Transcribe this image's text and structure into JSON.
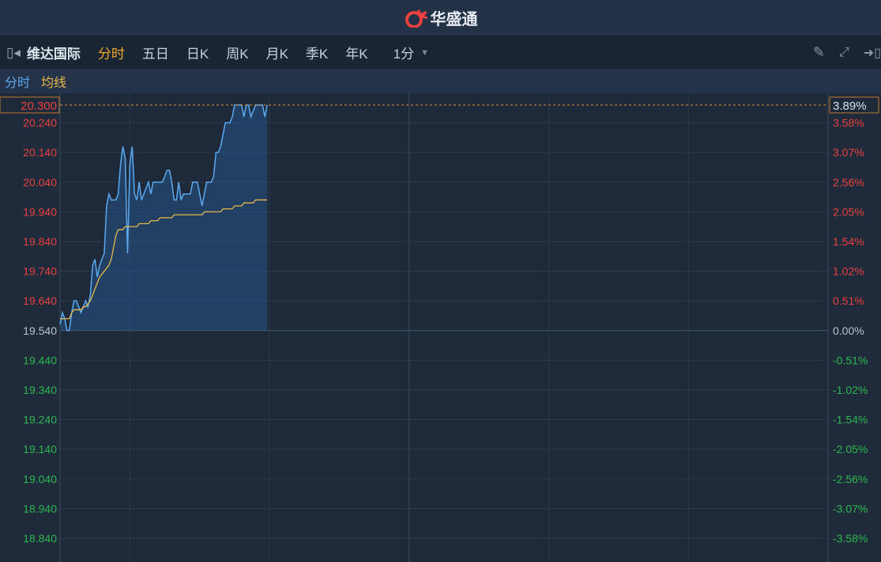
{
  "header": {
    "brand": "华盛通",
    "logo_icon": "huashengtong-logo"
  },
  "toolbar": {
    "stock_name": "维达国际",
    "tabs": [
      "分时",
      "五日",
      "日K",
      "周K",
      "月K",
      "季K",
      "年K"
    ],
    "active_tab": "分时",
    "interval": "1分"
  },
  "legend": {
    "line": "分时",
    "avg": "均线"
  },
  "colors": {
    "up": "#e8413e",
    "down": "#2db84d",
    "price_line": "#5aa9f0",
    "avg_line": "#e6b94a",
    "active": "#f0a830"
  },
  "chart_data": {
    "type": "line",
    "base_price": 19.54,
    "current_price_label": "20.300",
    "current_pct_label": "3.89%",
    "ylim": [
      18.8,
      20.3
    ],
    "y_ticks": [
      {
        "price": "20.240",
        "pct": "3.58%",
        "v": 20.24
      },
      {
        "price": "20.140",
        "pct": "3.07%",
        "v": 20.14
      },
      {
        "price": "20.040",
        "pct": "2.56%",
        "v": 20.04
      },
      {
        "price": "19.940",
        "pct": "2.05%",
        "v": 19.94
      },
      {
        "price": "19.840",
        "pct": "1.54%",
        "v": 19.84
      },
      {
        "price": "19.740",
        "pct": "1.02%",
        "v": 19.74
      },
      {
        "price": "19.640",
        "pct": "0.51%",
        "v": 19.64
      },
      {
        "price": "19.540",
        "pct": "0.00%",
        "v": 19.54
      },
      {
        "price": "19.440",
        "pct": "-0.51%",
        "v": 19.44
      },
      {
        "price": "19.340",
        "pct": "-1.02%",
        "v": 19.34
      },
      {
        "price": "19.240",
        "pct": "-1.54%",
        "v": 19.24
      },
      {
        "price": "19.140",
        "pct": "-2.05%",
        "v": 19.14
      },
      {
        "price": "19.040",
        "pct": "-2.56%",
        "v": 19.04
      },
      {
        "price": "18.940",
        "pct": "-3.07%",
        "v": 18.94
      },
      {
        "price": "18.840",
        "pct": "-3.58%",
        "v": 18.84
      }
    ],
    "session_minutes": 330,
    "vertical_grid_minutes": [
      30,
      90,
      150,
      210,
      270
    ],
    "series": [
      {
        "name": "分时",
        "values": [
          19.56,
          19.6,
          19.58,
          19.54,
          19.54,
          19.6,
          19.64,
          19.64,
          19.62,
          19.6,
          19.62,
          19.64,
          19.62,
          19.66,
          19.76,
          19.78,
          19.72,
          19.76,
          19.78,
          19.8,
          19.96,
          20.0,
          19.98,
          19.98,
          19.98,
          20.0,
          20.1,
          20.16,
          20.12,
          19.8,
          20.1,
          20.16,
          20.0,
          19.98,
          20.04,
          19.98,
          20.0,
          20.02,
          20.04,
          20.0,
          20.04,
          20.04,
          20.04,
          20.04,
          20.04,
          20.06,
          20.08,
          20.08,
          20.04,
          19.98,
          19.98,
          20.04,
          19.98,
          20.0,
          20.0,
          20.0,
          20.0,
          20.04,
          20.04,
          20.04,
          20.0,
          19.96,
          20.0,
          20.04,
          20.04,
          20.04,
          20.06,
          20.14,
          20.14,
          20.16,
          20.2,
          20.24,
          20.24,
          20.24,
          20.26,
          20.3,
          20.3,
          20.3,
          20.3,
          20.26,
          20.3,
          20.3,
          20.26,
          20.28,
          20.3,
          20.3,
          20.3,
          20.3,
          20.26,
          20.3
        ]
      },
      {
        "name": "均线",
        "values": [
          19.58,
          19.58,
          19.58,
          19.58,
          19.58,
          19.6,
          19.61,
          19.61,
          19.61,
          19.61,
          19.62,
          19.62,
          19.63,
          19.64,
          19.66,
          19.68,
          19.7,
          19.72,
          19.73,
          19.74,
          19.75,
          19.76,
          19.78,
          19.82,
          19.86,
          19.88,
          19.88,
          19.88,
          19.89,
          19.89,
          19.89,
          19.89,
          19.89,
          19.89,
          19.9,
          19.9,
          19.9,
          19.9,
          19.9,
          19.91,
          19.91,
          19.91,
          19.91,
          19.92,
          19.92,
          19.92,
          19.92,
          19.92,
          19.92,
          19.93,
          19.93,
          19.93,
          19.93,
          19.93,
          19.93,
          19.93,
          19.93,
          19.93,
          19.93,
          19.93,
          19.93,
          19.93,
          19.94,
          19.94,
          19.94,
          19.94,
          19.94,
          19.94,
          19.94,
          19.94,
          19.95,
          19.95,
          19.95,
          19.95,
          19.95,
          19.96,
          19.96,
          19.96,
          19.96,
          19.97,
          19.97,
          19.97,
          19.97,
          19.97,
          19.98,
          19.98,
          19.98,
          19.98,
          19.98,
          19.98
        ]
      }
    ]
  }
}
